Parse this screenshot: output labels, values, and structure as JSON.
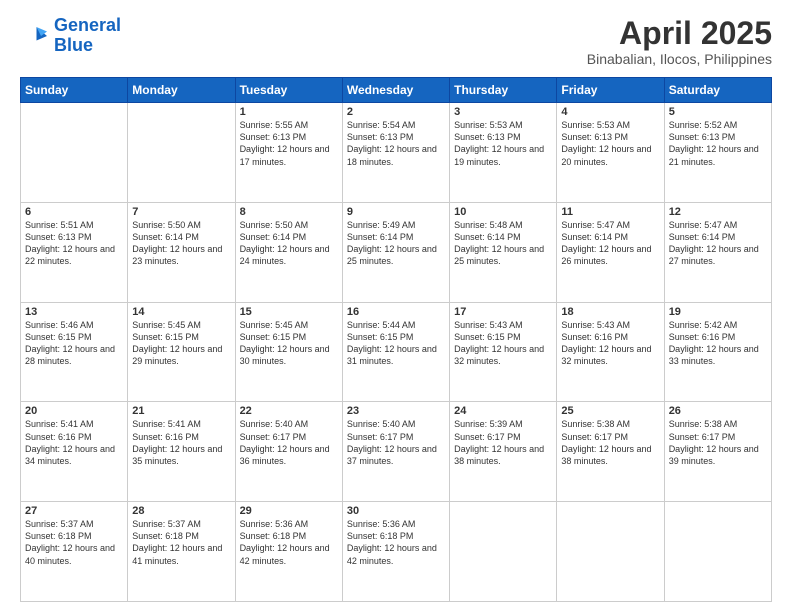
{
  "header": {
    "logo_line1": "General",
    "logo_line2": "Blue",
    "title": "April 2025",
    "location": "Binabalian, Ilocos, Philippines"
  },
  "weekdays": [
    "Sunday",
    "Monday",
    "Tuesday",
    "Wednesday",
    "Thursday",
    "Friday",
    "Saturday"
  ],
  "weeks": [
    [
      {
        "day": "",
        "info": ""
      },
      {
        "day": "",
        "info": ""
      },
      {
        "day": "1",
        "info": "Sunrise: 5:55 AM\nSunset: 6:13 PM\nDaylight: 12 hours and 17 minutes."
      },
      {
        "day": "2",
        "info": "Sunrise: 5:54 AM\nSunset: 6:13 PM\nDaylight: 12 hours and 18 minutes."
      },
      {
        "day": "3",
        "info": "Sunrise: 5:53 AM\nSunset: 6:13 PM\nDaylight: 12 hours and 19 minutes."
      },
      {
        "day": "4",
        "info": "Sunrise: 5:53 AM\nSunset: 6:13 PM\nDaylight: 12 hours and 20 minutes."
      },
      {
        "day": "5",
        "info": "Sunrise: 5:52 AM\nSunset: 6:13 PM\nDaylight: 12 hours and 21 minutes."
      }
    ],
    [
      {
        "day": "6",
        "info": "Sunrise: 5:51 AM\nSunset: 6:13 PM\nDaylight: 12 hours and 22 minutes."
      },
      {
        "day": "7",
        "info": "Sunrise: 5:50 AM\nSunset: 6:14 PM\nDaylight: 12 hours and 23 minutes."
      },
      {
        "day": "8",
        "info": "Sunrise: 5:50 AM\nSunset: 6:14 PM\nDaylight: 12 hours and 24 minutes."
      },
      {
        "day": "9",
        "info": "Sunrise: 5:49 AM\nSunset: 6:14 PM\nDaylight: 12 hours and 25 minutes."
      },
      {
        "day": "10",
        "info": "Sunrise: 5:48 AM\nSunset: 6:14 PM\nDaylight: 12 hours and 25 minutes."
      },
      {
        "day": "11",
        "info": "Sunrise: 5:47 AM\nSunset: 6:14 PM\nDaylight: 12 hours and 26 minutes."
      },
      {
        "day": "12",
        "info": "Sunrise: 5:47 AM\nSunset: 6:14 PM\nDaylight: 12 hours and 27 minutes."
      }
    ],
    [
      {
        "day": "13",
        "info": "Sunrise: 5:46 AM\nSunset: 6:15 PM\nDaylight: 12 hours and 28 minutes."
      },
      {
        "day": "14",
        "info": "Sunrise: 5:45 AM\nSunset: 6:15 PM\nDaylight: 12 hours and 29 minutes."
      },
      {
        "day": "15",
        "info": "Sunrise: 5:45 AM\nSunset: 6:15 PM\nDaylight: 12 hours and 30 minutes."
      },
      {
        "day": "16",
        "info": "Sunrise: 5:44 AM\nSunset: 6:15 PM\nDaylight: 12 hours and 31 minutes."
      },
      {
        "day": "17",
        "info": "Sunrise: 5:43 AM\nSunset: 6:15 PM\nDaylight: 12 hours and 32 minutes."
      },
      {
        "day": "18",
        "info": "Sunrise: 5:43 AM\nSunset: 6:16 PM\nDaylight: 12 hours and 32 minutes."
      },
      {
        "day": "19",
        "info": "Sunrise: 5:42 AM\nSunset: 6:16 PM\nDaylight: 12 hours and 33 minutes."
      }
    ],
    [
      {
        "day": "20",
        "info": "Sunrise: 5:41 AM\nSunset: 6:16 PM\nDaylight: 12 hours and 34 minutes."
      },
      {
        "day": "21",
        "info": "Sunrise: 5:41 AM\nSunset: 6:16 PM\nDaylight: 12 hours and 35 minutes."
      },
      {
        "day": "22",
        "info": "Sunrise: 5:40 AM\nSunset: 6:17 PM\nDaylight: 12 hours and 36 minutes."
      },
      {
        "day": "23",
        "info": "Sunrise: 5:40 AM\nSunset: 6:17 PM\nDaylight: 12 hours and 37 minutes."
      },
      {
        "day": "24",
        "info": "Sunrise: 5:39 AM\nSunset: 6:17 PM\nDaylight: 12 hours and 38 minutes."
      },
      {
        "day": "25",
        "info": "Sunrise: 5:38 AM\nSunset: 6:17 PM\nDaylight: 12 hours and 38 minutes."
      },
      {
        "day": "26",
        "info": "Sunrise: 5:38 AM\nSunset: 6:17 PM\nDaylight: 12 hours and 39 minutes."
      }
    ],
    [
      {
        "day": "27",
        "info": "Sunrise: 5:37 AM\nSunset: 6:18 PM\nDaylight: 12 hours and 40 minutes."
      },
      {
        "day": "28",
        "info": "Sunrise: 5:37 AM\nSunset: 6:18 PM\nDaylight: 12 hours and 41 minutes."
      },
      {
        "day": "29",
        "info": "Sunrise: 5:36 AM\nSunset: 6:18 PM\nDaylight: 12 hours and 42 minutes."
      },
      {
        "day": "30",
        "info": "Sunrise: 5:36 AM\nSunset: 6:18 PM\nDaylight: 12 hours and 42 minutes."
      },
      {
        "day": "",
        "info": ""
      },
      {
        "day": "",
        "info": ""
      },
      {
        "day": "",
        "info": ""
      }
    ]
  ]
}
